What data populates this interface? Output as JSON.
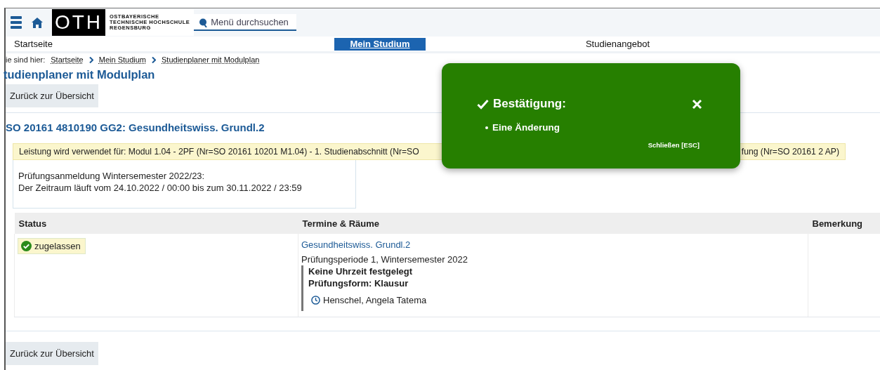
{
  "header": {
    "logo_mark": "OTH",
    "logo_text": [
      "OSTBAYERISCHE",
      "TECHNISCHE HOCHSCHULE",
      "REGENSBURG"
    ],
    "search": {
      "placeholder": "Menü durchsuchen"
    }
  },
  "nav": [
    {
      "label": "Startseite",
      "selected": false
    },
    {
      "label": "Mein Studium",
      "selected": true
    },
    {
      "label": "Studienangebot",
      "selected": false
    }
  ],
  "breadcrumb": {
    "prefix": "ie sind hier:",
    "items": [
      "Startseite",
      "Mein Studium",
      "Studienplaner mit Modulplan"
    ]
  },
  "page_title": "tudienplaner mit Modulplan",
  "back_button_top": "Zurück zur Übersicht",
  "module_title": "SO 20161 4810190 GG2: Gesundheitswiss. Grundl.2",
  "usage_note": {
    "start": "Leistung wird verwendet für: Modul 1.04 - 2PF (Nr=SO 20161 10201 M1.04) - 1. Studienabschnitt (Nr=SO",
    "end": "fung (Nr=SO 20161 2 AP)"
  },
  "registration_info": [
    "Prüfungsanmeldung Wintersemester 2022/23:",
    "Der Zeitraum läuft vom 24.10.2022 / 00:00 bis zum 30.11.2022 / 23:59"
  ],
  "table": {
    "columns": [
      "Status",
      "Termine & Räume",
      "Bemerkung"
    ],
    "rows": [
      {
        "status": "zugelassen",
        "exam_link": "Gesundheitswiss. Grundl.2",
        "period": "Prüfungsperiode 1, Wintersemester 2022",
        "time": "Keine Uhrzeit festgelegt",
        "form": "Prüfungsform: Klausur",
        "examiner": "Henschel, Angela Tatema"
      }
    ]
  },
  "back_button_bottom": "Zurück zur Übersicht",
  "toast": {
    "title": "Bestätigung:",
    "items": [
      "Eine Änderung"
    ],
    "close_hint": "Schließen [ESC]"
  }
}
